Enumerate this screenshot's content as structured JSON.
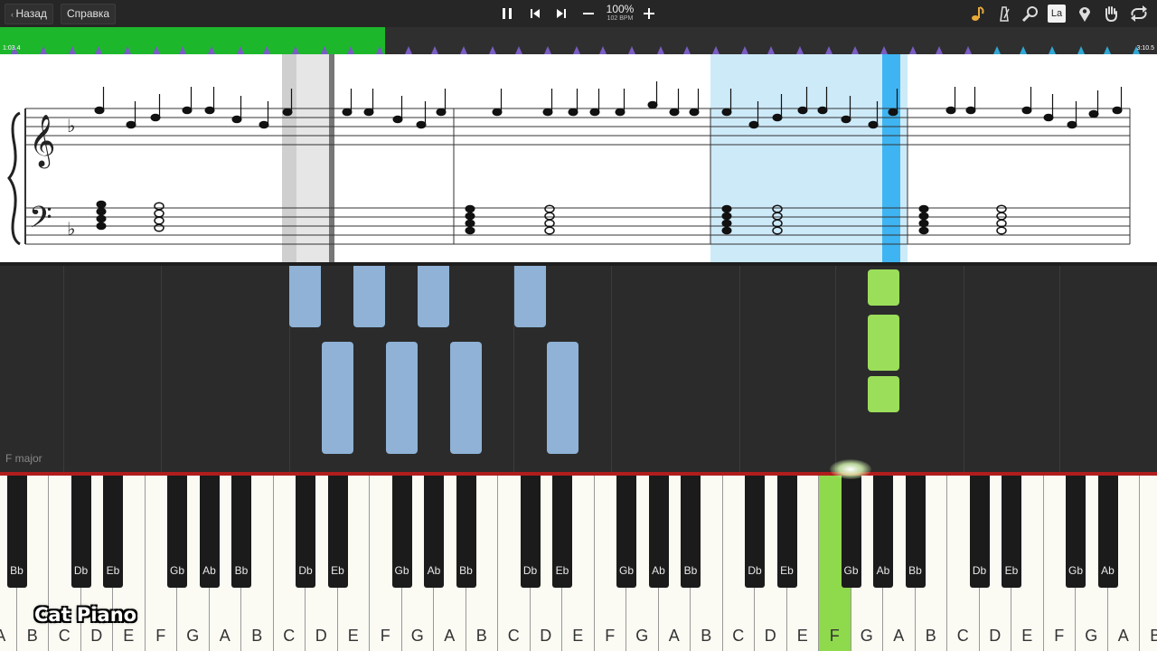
{
  "toolbar": {
    "back_label": "Назад",
    "help_label": "Справка",
    "zoom": "100%",
    "bpm": "102 BPM",
    "language_badge": "La"
  },
  "toolbar_icons": [
    "pause-icon",
    "skip-back-icon",
    "skip-forward-icon",
    "minus-icon",
    "plus-icon",
    "music-note-icon",
    "metronome-icon",
    "magnifier-icon",
    "language-icon",
    "location-pin-icon",
    "hand-icon",
    "loop-icon"
  ],
  "timeline": {
    "current_time": "1:03.4",
    "total_time": "3:10.5",
    "progress": 0.333
  },
  "piano_roll": {
    "key_signature_label": "F major"
  },
  "keyboard": {
    "active_key": "F",
    "white_keys": [
      "A",
      "B",
      "C",
      "D",
      "E",
      "F",
      "G",
      "A",
      "B",
      "C",
      "D",
      "E",
      "F",
      "G",
      "A",
      "B",
      "C",
      "D",
      "E",
      "F",
      "G",
      "A",
      "B",
      "C",
      "D",
      "E",
      "F",
      "G",
      "A",
      "B",
      "C",
      "D",
      "E",
      "F",
      "G",
      "A",
      "B"
    ],
    "black_keys": [
      "Bb",
      "Db",
      "Eb",
      "Gb",
      "Ab",
      "Bb",
      "Db",
      "Eb",
      "Gb",
      "Ab",
      "Bb",
      "Db",
      "Eb",
      "Gb",
      "Ab",
      "Bb",
      "Db",
      "Eb",
      "Gb",
      "Ab",
      "Bb",
      "Db",
      "Eb",
      "Gb",
      "Ab"
    ]
  },
  "colors": {
    "progress": "#1db72c",
    "highlight": "#cdeaf9",
    "playhead": "#3fb4f2",
    "active_key": "#8fd94d",
    "note_left_hand": "#8fb2d6",
    "note_right_hand": "#9bde5a"
  },
  "watermark": "Cat Piano"
}
